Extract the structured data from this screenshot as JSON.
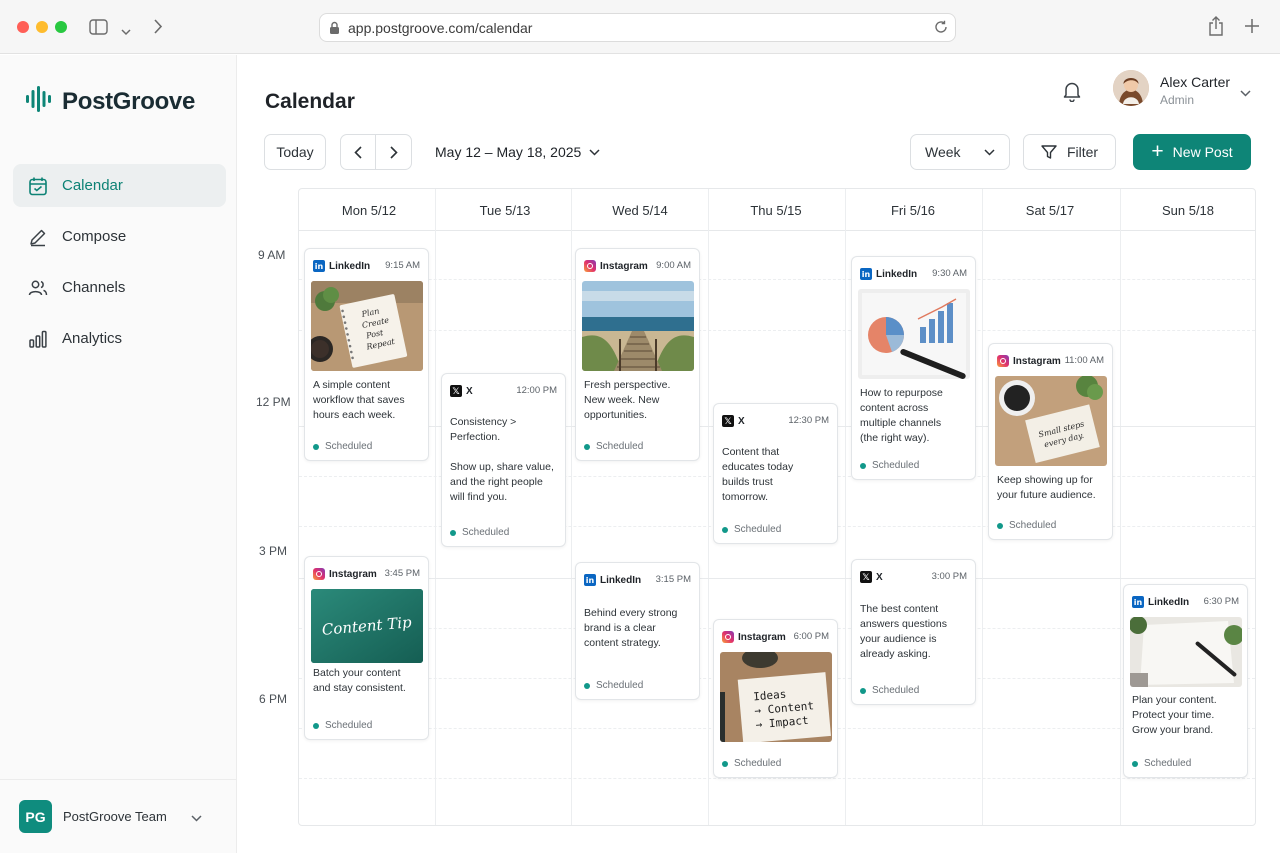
{
  "browser": {
    "url": "app.postgroove.com/calendar"
  },
  "app": {
    "name": "PostGroove",
    "accent": "#0e8577"
  },
  "sidebar": {
    "items": [
      {
        "label": "Calendar",
        "icon": "calendar-icon",
        "active": true
      },
      {
        "label": "Compose",
        "icon": "pencil-icon"
      },
      {
        "label": "Channels",
        "icon": "users-icon"
      },
      {
        "label": "Analytics",
        "icon": "bar-chart-icon"
      }
    ],
    "team": {
      "initials": "PG",
      "name": "PostGroove Team"
    }
  },
  "header": {
    "title": "Calendar",
    "user": {
      "name": "Alex Carter",
      "role": "Admin"
    }
  },
  "toolbar": {
    "today": "Today",
    "range": "May 12 – May 18, 2025",
    "view": "Week",
    "filter": "Filter",
    "new_post": "New Post"
  },
  "calendar": {
    "days": [
      "Mon 5/12",
      "Tue 5/13",
      "Wed 5/14",
      "Thu 5/15",
      "Fri 5/16",
      "Sat 5/17",
      "Sun 5/18"
    ],
    "times": [
      "9 AM",
      "12 PM",
      "3 PM",
      "6 PM"
    ],
    "posts": [
      {
        "day": "Mon 5/12",
        "network": "LinkedIn",
        "time": "9:15 AM",
        "image": "notebook-plan",
        "image_text": "Plan\nCreate\nPost\nRepeat",
        "text": "A simple content\nworkflow that saves\nhours each week.",
        "status": "Scheduled"
      },
      {
        "day": "Mon 5/12",
        "network": "Instagram",
        "time": "3:45 PM",
        "image": "content-tip-card",
        "image_text": "Content Tip",
        "text": "Batch your content\nand stay consistent.",
        "status": "Scheduled"
      },
      {
        "day": "Tue 5/13",
        "network": "X",
        "time": "12:00 PM",
        "text": "Consistency >\nPerfection.\n\nShow up, share value,\nand the right people\nwill find you.",
        "status": "Scheduled"
      },
      {
        "day": "Wed 5/14",
        "network": "Instagram",
        "time": "9:00 AM",
        "image": "beach-boardwalk",
        "text": "Fresh perspective.\nNew week. New\nopportunities.",
        "status": "Scheduled"
      },
      {
        "day": "Wed 5/14",
        "network": "LinkedIn",
        "time": "3:15 PM",
        "text": "Behind every strong\nbrand is a clear\ncontent strategy.",
        "status": "Scheduled"
      },
      {
        "day": "Thu 5/15",
        "network": "X",
        "time": "12:30 PM",
        "text": "Content that\neducates today\nbuilds trust\ntomorrow.",
        "status": "Scheduled"
      },
      {
        "day": "Thu 5/15",
        "network": "Instagram",
        "time": "6:00 PM",
        "image": "ideas-note",
        "image_text": "Ideas\n→ Content\n→ Impact",
        "text": "",
        "status": "Scheduled"
      },
      {
        "day": "Fri 5/16",
        "network": "LinkedIn",
        "time": "9:30 AM",
        "image": "charts-desk",
        "text": "How to repurpose\ncontent across\nmultiple channels\n(the right way).",
        "status": "Scheduled"
      },
      {
        "day": "Fri 5/16",
        "network": "X",
        "time": "3:00 PM",
        "text": "The best content\nanswers questions\nyour audience is\nalready asking.",
        "status": "Scheduled"
      },
      {
        "day": "Sat 5/17",
        "network": "Instagram",
        "time": "11:00 AM",
        "image": "coffee-note",
        "image_text": "Small steps\nevery day.",
        "text": "Keep showing up for\nyour future audience.",
        "status": "Scheduled"
      },
      {
        "day": "Sun 5/18",
        "network": "LinkedIn",
        "time": "6:30 PM",
        "image": "notebook-pen",
        "text": "Plan your content.\nProtect your time.\nGrow your brand.",
        "status": "Scheduled"
      }
    ]
  }
}
